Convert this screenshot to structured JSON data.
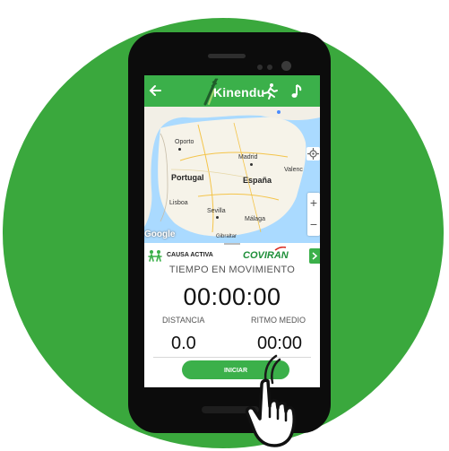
{
  "app": {
    "logo_text": "Kinendu",
    "accent_color": "#3bb04a",
    "background_color": "#3aa83d"
  },
  "toolbar": {
    "back_icon": "arrow-left-icon",
    "activity_icon": "runner-icon",
    "music_icon": "music-note-icon"
  },
  "map": {
    "country_label": "España",
    "labels": {
      "portugal": "Portugal",
      "porto": "Oporto",
      "madrid": "Madrid",
      "lisboa": "Lisboa",
      "sevilla": "Sevilla",
      "malaga": "Málaga",
      "valencia": "Valenc",
      "gibraltar": "Gibraltar"
    },
    "provider_logo": "Google",
    "zoom_in": "+",
    "zoom_out": "−"
  },
  "sponsors": {
    "causa_activa": "CAUSA ACTIVA",
    "coviran": "COVIRAN"
  },
  "tracking": {
    "moving_time_label": "TIEMPO EN MOVIMIENTO",
    "moving_time_value": "00:00:00",
    "distance_label": "DISTANCIA",
    "distance_value": "0.0",
    "pace_label": "RITMO MEDIO",
    "pace_value": "00:00"
  },
  "actions": {
    "start_label": "INICIAR"
  }
}
